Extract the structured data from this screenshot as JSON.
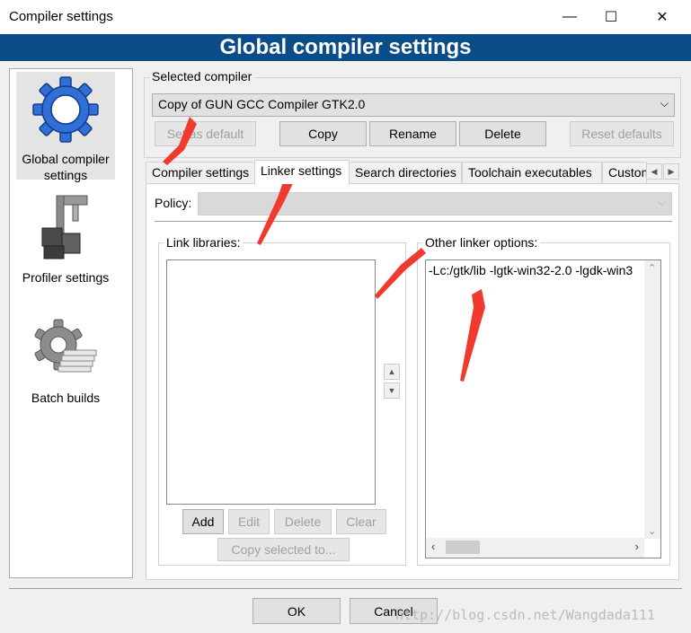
{
  "window": {
    "title": "Compiler settings",
    "minimize_glyph": "—",
    "maximize_glyph": "☐",
    "close_glyph": "✕"
  },
  "banner": {
    "title": "Global compiler settings"
  },
  "sidebar": {
    "items": [
      {
        "label_line1": "Global compiler",
        "label_line2": "settings",
        "icon": "gear-icon",
        "selected": true
      },
      {
        "label": "Profiler settings",
        "icon": "caliper-icon"
      },
      {
        "label": "Batch builds",
        "icon": "batch-gear-icon"
      }
    ]
  },
  "selected_compiler": {
    "group_label": "Selected compiler",
    "value": "Copy of GUN GCC Compiler GTK2.0",
    "buttons": {
      "set_default": "Set as default",
      "copy": "Copy",
      "rename": "Rename",
      "delete": "Delete",
      "reset_defaults": "Reset defaults"
    }
  },
  "tabs": [
    {
      "label": "Compiler settings"
    },
    {
      "label": "Linker settings",
      "active": true
    },
    {
      "label": "Search directories"
    },
    {
      "label": "Toolchain executables"
    },
    {
      "label": "Custom variables"
    }
  ],
  "linker": {
    "policy_label": "Policy:",
    "policy_value": "",
    "link_libraries_label": "Link libraries:",
    "link_libraries": [],
    "buttons": {
      "add": "Add",
      "edit": "Edit",
      "delete": "Delete",
      "clear": "Clear",
      "copy_selected": "Copy selected to..."
    },
    "other_options_label": "Other linker options:",
    "other_options_text": "-Lc:/gtk/lib -lgtk-win32-2.0 -lgdk-win3"
  },
  "footer": {
    "ok": "OK",
    "cancel": "Cancel",
    "watermark": "http://blog.csdn.net/Wangdada111"
  },
  "colors": {
    "banner": "#0b4d88",
    "annotation_arrow": "#f03a2e"
  }
}
